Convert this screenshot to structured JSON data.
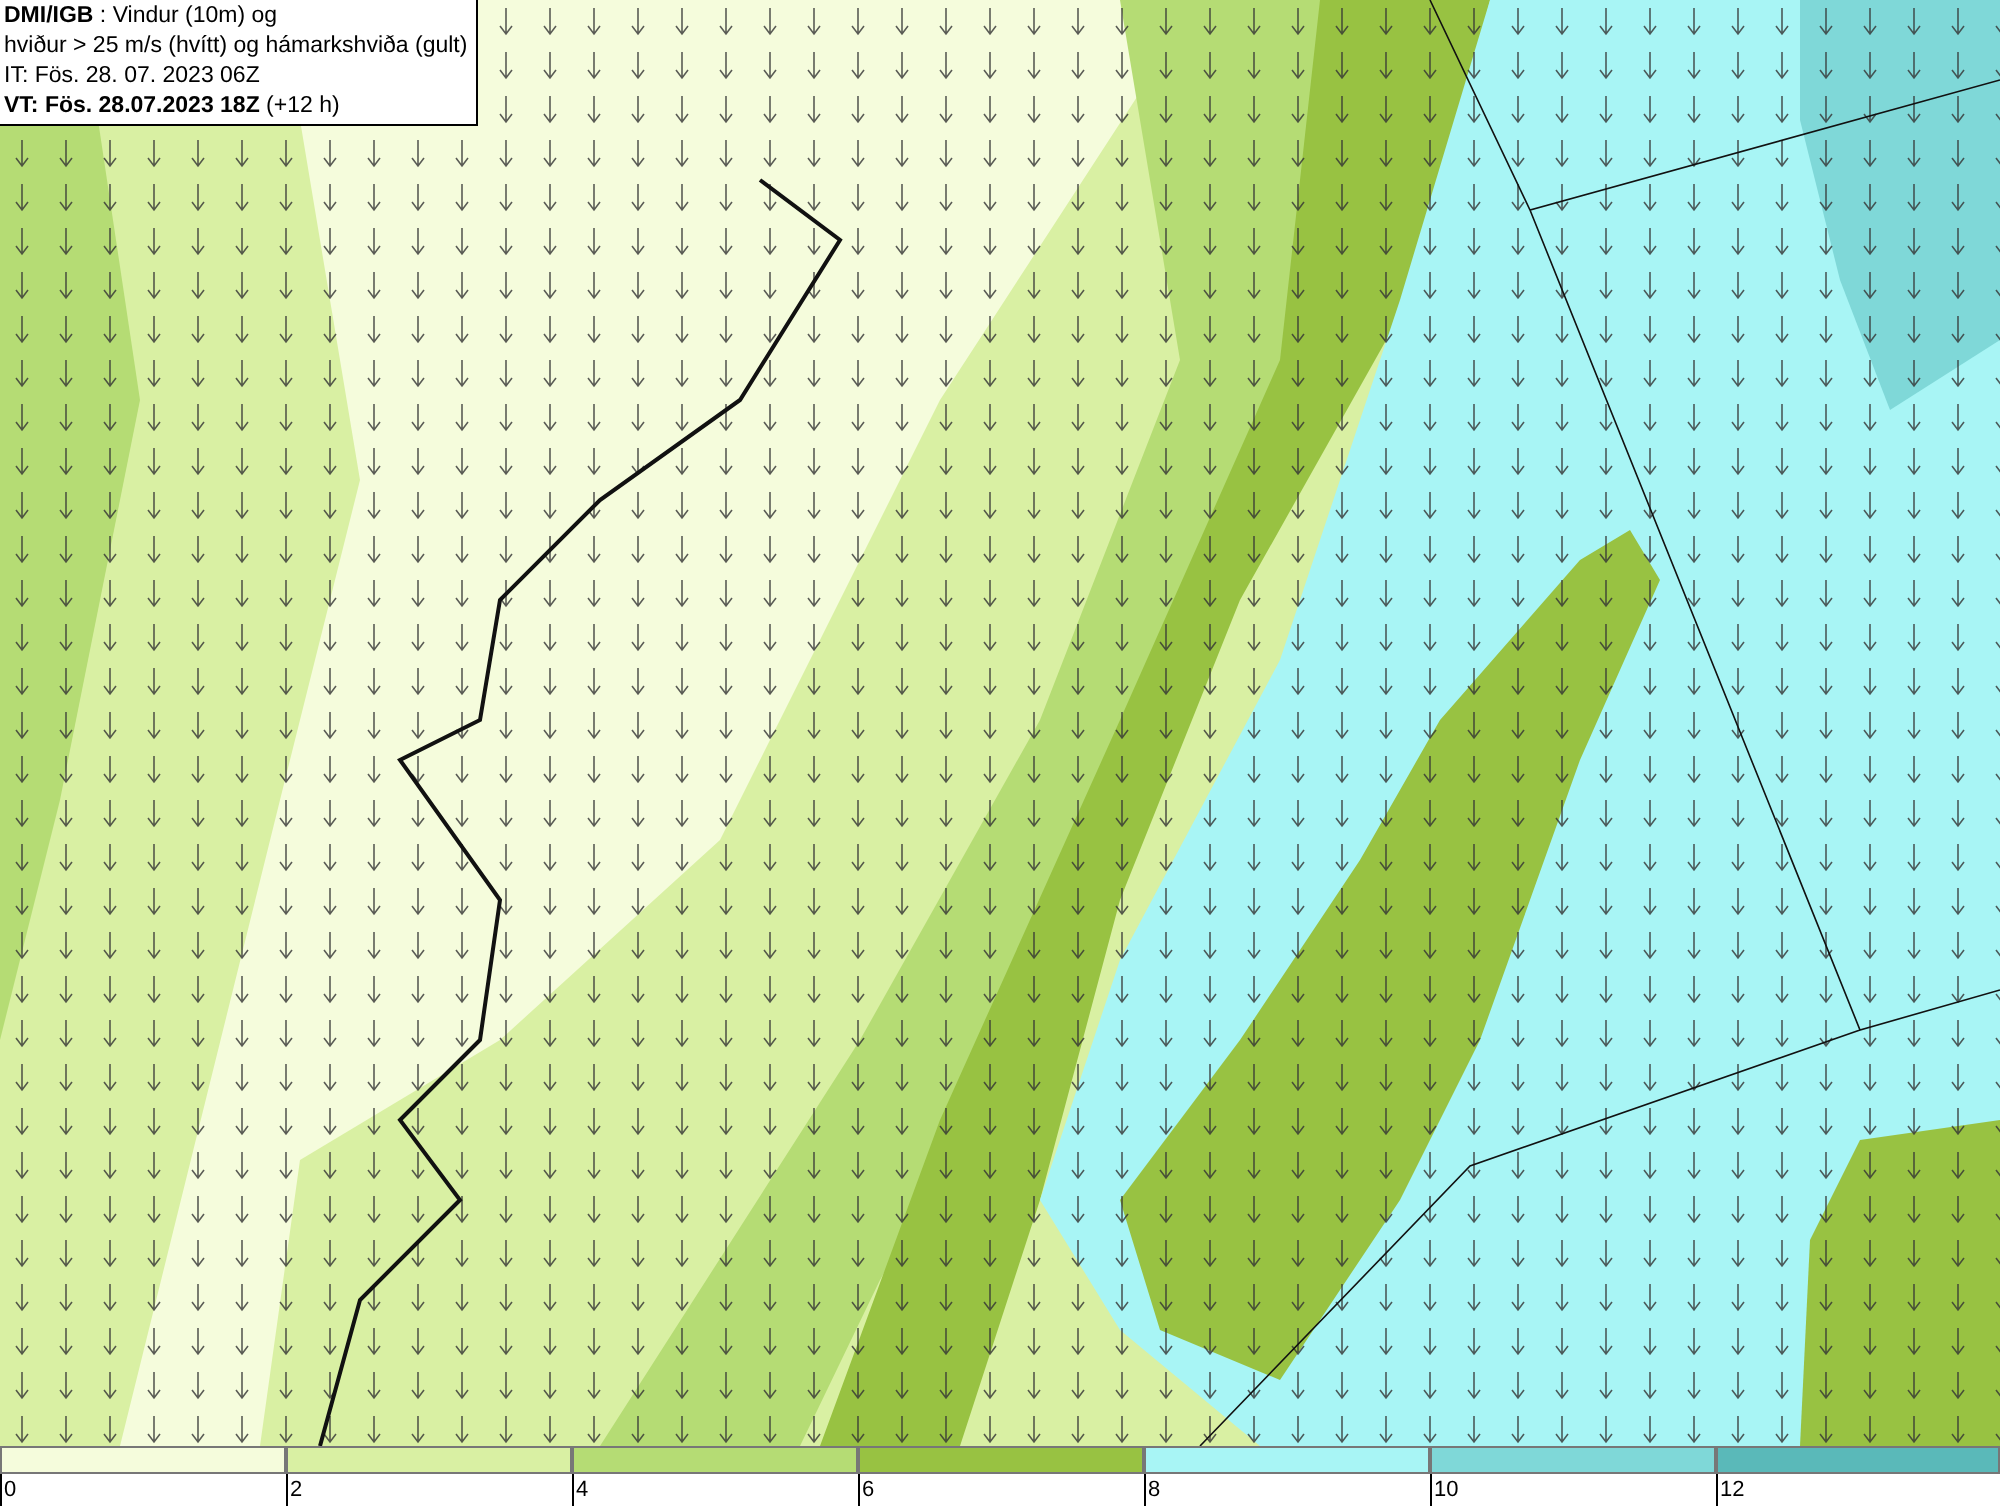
{
  "title_box": {
    "lines": [
      "**DMI/IGB** : Vindur (10m) og",
      "hviður > 25 m/s (hvítt) og hámarkshviða (gult)",
      "IT: Fös. 28. 07. 2023 06Z",
      "**VT: Fös. 28.07.2023 18Z** (+12 h)"
    ]
  },
  "legend": {
    "segments": [
      {
        "color": "#f5fcdc"
      },
      {
        "color": "#d9f0a3"
      },
      {
        "color": "#b5dc74"
      },
      {
        "color": "#98c242"
      },
      {
        "color": "#a8f5f5"
      },
      {
        "color": "#7fd8d8"
      },
      {
        "color": "#5ab9b9"
      }
    ],
    "ticks": [
      "0",
      "2",
      "4",
      "6",
      "8",
      "10",
      "12"
    ]
  }
}
